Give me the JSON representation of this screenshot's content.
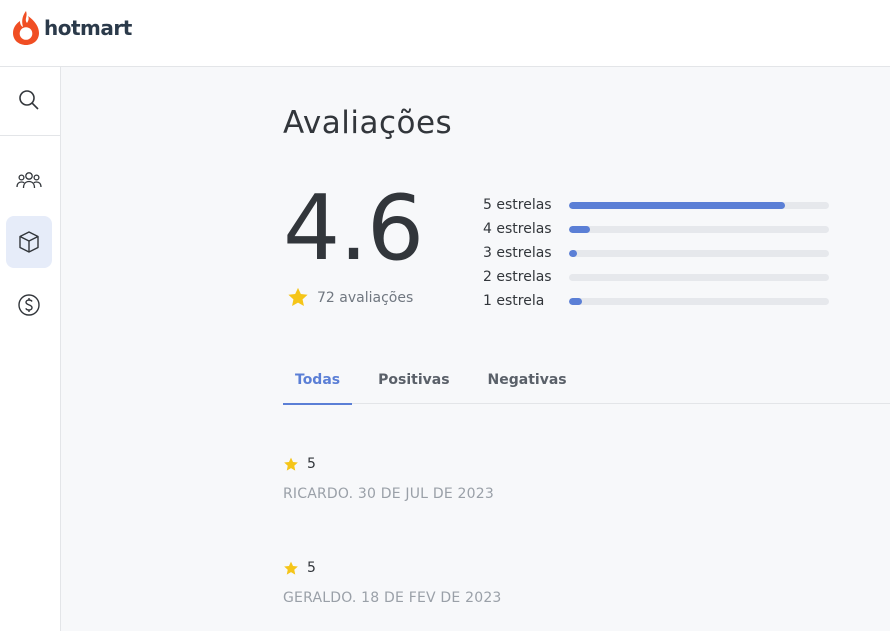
{
  "brand": {
    "name": "hotmart",
    "color": "#f04e23"
  },
  "sidebar": {
    "items": [
      {
        "icon": "search-icon",
        "active": false
      },
      {
        "icon": "users-icon",
        "active": false
      },
      {
        "icon": "box-icon",
        "active": true
      },
      {
        "icon": "dollar-icon",
        "active": false
      }
    ]
  },
  "page": {
    "title": "Avaliações"
  },
  "summary": {
    "score": "4.6",
    "count_label": "72 avaliações"
  },
  "distribution": [
    {
      "label": "5 estrelas",
      "fraction": 0.83
    },
    {
      "label": "4 estrelas",
      "fraction": 0.08
    },
    {
      "label": "3 estrelas",
      "fraction": 0.03
    },
    {
      "label": "2 estrelas",
      "fraction": 0.0
    },
    {
      "label": "1 estrela",
      "fraction": 0.05
    }
  ],
  "tabs": [
    {
      "label": "Todas",
      "active": true
    },
    {
      "label": "Positivas",
      "active": false
    },
    {
      "label": "Negativas",
      "active": false
    }
  ],
  "reviews": [
    {
      "rating": "5",
      "meta": "RICARDO. 30 DE JUL DE 2023"
    },
    {
      "rating": "5",
      "meta": "GERALDO. 18 DE FEV DE 2023"
    }
  ],
  "colors": {
    "accent": "#5b7fd6",
    "star": "#f5c518"
  }
}
